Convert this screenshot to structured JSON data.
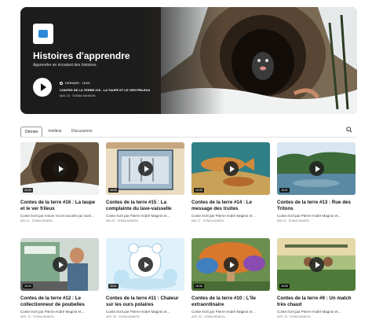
{
  "hero": {
    "title": "Histoires d'apprendre",
    "subtitle": "Apprendre en écoutant des histoires.",
    "duration": "DERNIER · 16:05",
    "episode": "CONTES DE LA TERRE #16 - LA TAUPE ET LE VER FRILEUX",
    "date": "MAI 13 · SONIA MANION"
  },
  "tabs": [
    "Dernier",
    "meilleur",
    "Discussions"
  ],
  "active_tab": "Dernier",
  "episodes": [
    {
      "title": "Contes de la terre #16 : La taupe et le ver frileux",
      "desc": "Conte écrit par Antoin Voi et raconté par Soni…",
      "date": "MAI 13 · SONIA MANION",
      "duration": "16:05"
    },
    {
      "title": "Contes de la terre #15 : La complainte du lave-vaisselle",
      "desc": "Conte écrit par Pierre-André Magnin et…",
      "date": "MAI 04 · SONIA MANION",
      "duration": "16:05"
    },
    {
      "title": "Contes de la terre #14 : Le message des truites",
      "desc": "Conte écrit par Pierre-André Magnin et…",
      "date": "MAI 17 · SONIA MANION",
      "duration": "16:08"
    },
    {
      "title": "Contes de la terre #13 : Rue des Tritons",
      "desc": "Conte écrit par Pierre-André Magnin et…",
      "date": "MAI 03 · SONIA MANION",
      "duration": "16:21"
    },
    {
      "title": "Contes de la terre #12 : Le collectionneur de poubelles",
      "desc": "Conte écrit par Pierre-André Magnin et…",
      "date": "AVR. 19 · SONIA MANION",
      "duration": "16:24"
    },
    {
      "title": "Contes de la terre #11 : Chaleur sur les ours polaires",
      "desc": "Conte écrit par Pierre-André Magnin et…",
      "date": "AVR. 03 · SONIA MANION",
      "duration": "16:01"
    },
    {
      "title": "Contes de la terre #10 : L'île extraordinaire",
      "desc": "Conte écrit par Pierre-André Magnin et…",
      "date": "AVR. 04 · SONIA MANION",
      "duration": "16:06"
    },
    {
      "title": "Contes de la terre #9 : Un match très chaud",
      "desc": "Conte écrit par Pierre-André Magnin et…",
      "date": "AVR. 25 · SONIA MANION",
      "duration": "16:06"
    }
  ]
}
